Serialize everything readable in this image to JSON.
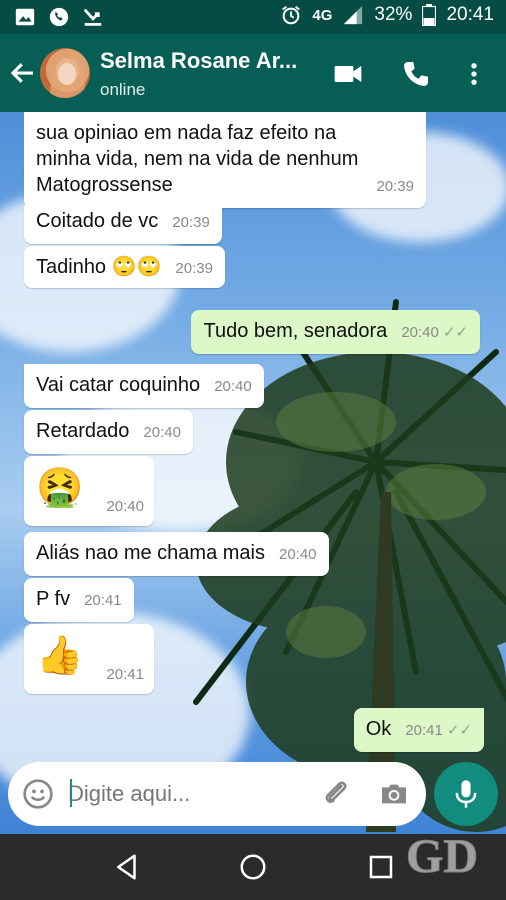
{
  "status_bar": {
    "network": "4G",
    "battery": "32%",
    "time": "20:41",
    "icons": [
      "image-icon",
      "whatsapp-icon",
      "missed-call-icon",
      "alarm-icon",
      "signal-icon",
      "battery-icon"
    ]
  },
  "header": {
    "contact_name": "Selma Rosane Ar...",
    "status": "online",
    "icons": [
      "back-arrow-icon",
      "video-call-icon",
      "phone-icon",
      "more-vert-icon"
    ]
  },
  "messages": [
    {
      "dir": "in",
      "text": "sua opiniao em nada faz efeito na\nminha vida,  nem na vida de nenhum\nMatogrossense",
      "time": "20:39"
    },
    {
      "dir": "in",
      "text": "Coitado de vc",
      "time": "20:39"
    },
    {
      "dir": "in",
      "text": "Tadinho 🙄🙄",
      "time": "20:39"
    },
    {
      "dir": "out",
      "text": "Tudo bem, senadora",
      "time": "20:40",
      "ticks": "✓✓"
    },
    {
      "dir": "in",
      "text": "Vai catar coquinho",
      "time": "20:40"
    },
    {
      "dir": "in",
      "text": "Retardado",
      "time": "20:40"
    },
    {
      "dir": "in",
      "text": "🤮",
      "time": "20:40"
    },
    {
      "dir": "in",
      "text": "Aliás nao me chama  mais",
      "time": "20:40"
    },
    {
      "dir": "in",
      "text": "P fv",
      "time": "20:41"
    },
    {
      "dir": "in",
      "text": "👍",
      "time": "20:41"
    },
    {
      "dir": "out",
      "text": "Ok",
      "time": "20:41",
      "ticks": "✓✓"
    }
  ],
  "composer": {
    "placeholder": "Digite aqui...",
    "icons": [
      "emoji-icon",
      "attach-icon",
      "camera-icon",
      "mic-icon"
    ]
  },
  "watermark": "GD",
  "colors": {
    "header": "#075e54",
    "status_bar": "#054d44",
    "outgoing_bubble": "#dcf8c6",
    "incoming_bubble": "#ffffff",
    "accent": "#128c7e"
  }
}
